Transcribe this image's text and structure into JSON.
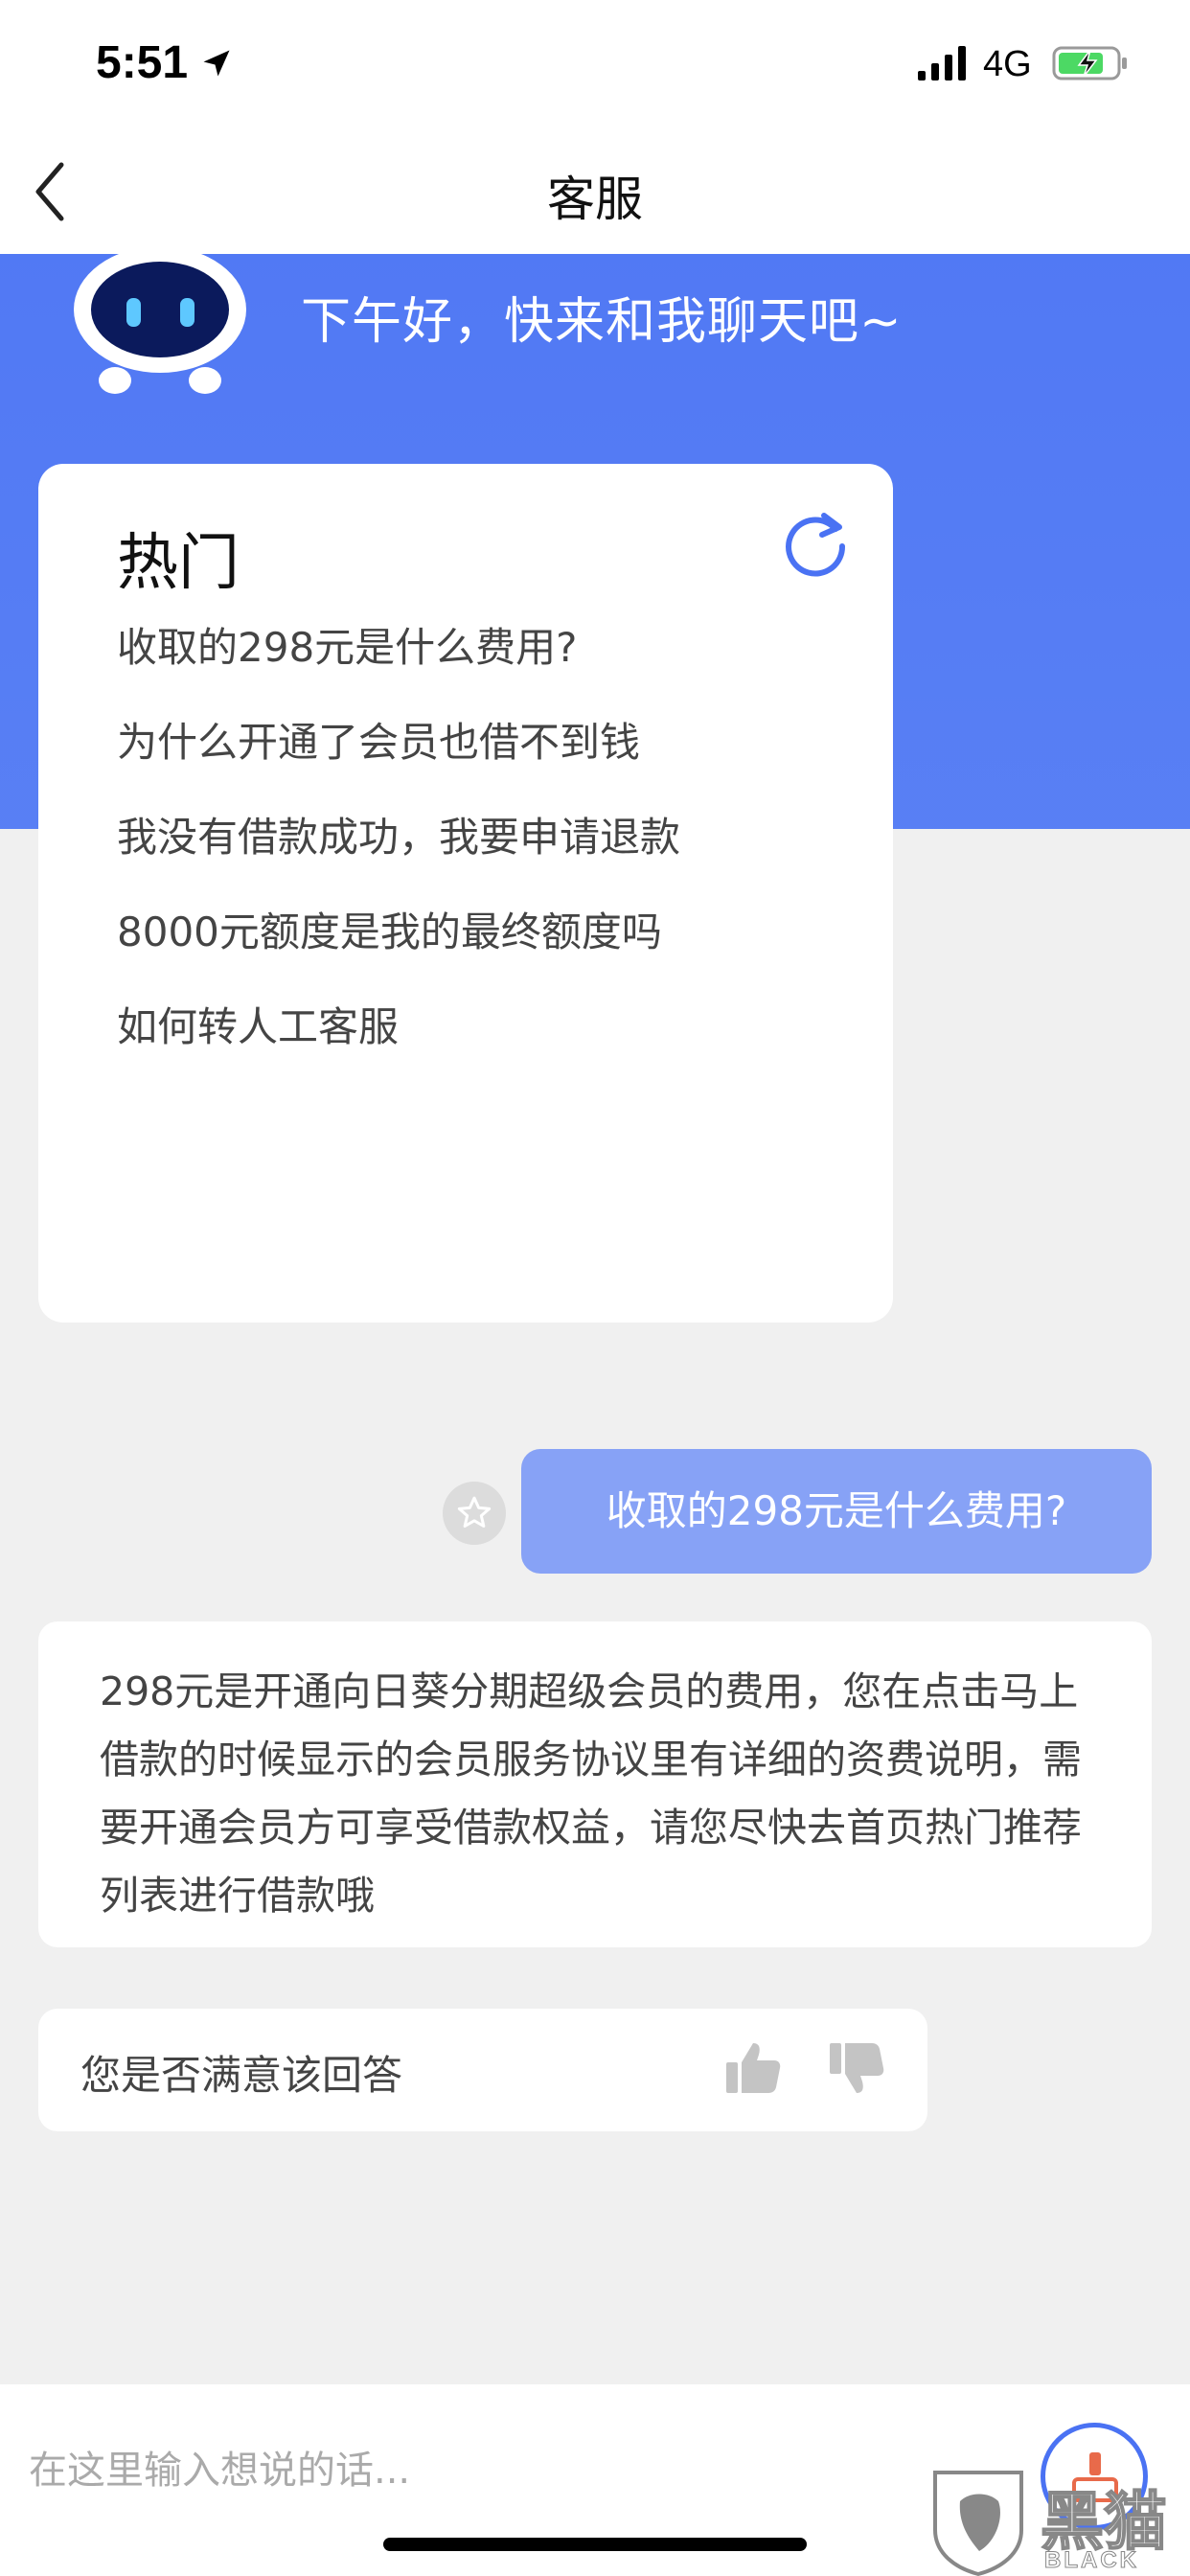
{
  "status_bar": {
    "time": "5:51",
    "network": "4G"
  },
  "nav": {
    "title": "客服"
  },
  "hero": {
    "greeting": "下午好，快来和我聊天吧~"
  },
  "hot_questions": {
    "title": "热门",
    "items": [
      "收取的298元是什么费用?",
      "为什么开通了会员也借不到钱",
      "我没有借款成功，我要申请退款",
      "8000元额度是我的最终额度吗",
      "如何转人工客服"
    ]
  },
  "chat": {
    "user_message": "收取的298元是什么费用?",
    "bot_reply": "298元是开通向日葵分期超级会员的费用，您在点击马上借款的时候显示的会员服务协议里有详细的资费说明，需要开通会员方可享受借款权益，请您尽快去首页热门推荐列表进行借款哦",
    "feedback_question": "您是否满意该回答"
  },
  "input": {
    "placeholder": "在这里输入想说的话..."
  },
  "watermark": {
    "title": "黑猫",
    "subtitle": "BLACK CAT"
  },
  "colors": {
    "brand_blue": "#4a72f3",
    "user_bubble": "#87a2f6",
    "page_background": "#f0f0f0"
  },
  "icons": [
    "location-arrow-icon",
    "signal-icon",
    "battery-charging-icon",
    "back-chevron-icon",
    "robot-avatar",
    "refresh-icon",
    "star-icon",
    "thumb-up-icon",
    "thumb-down-icon",
    "send-icon"
  ]
}
